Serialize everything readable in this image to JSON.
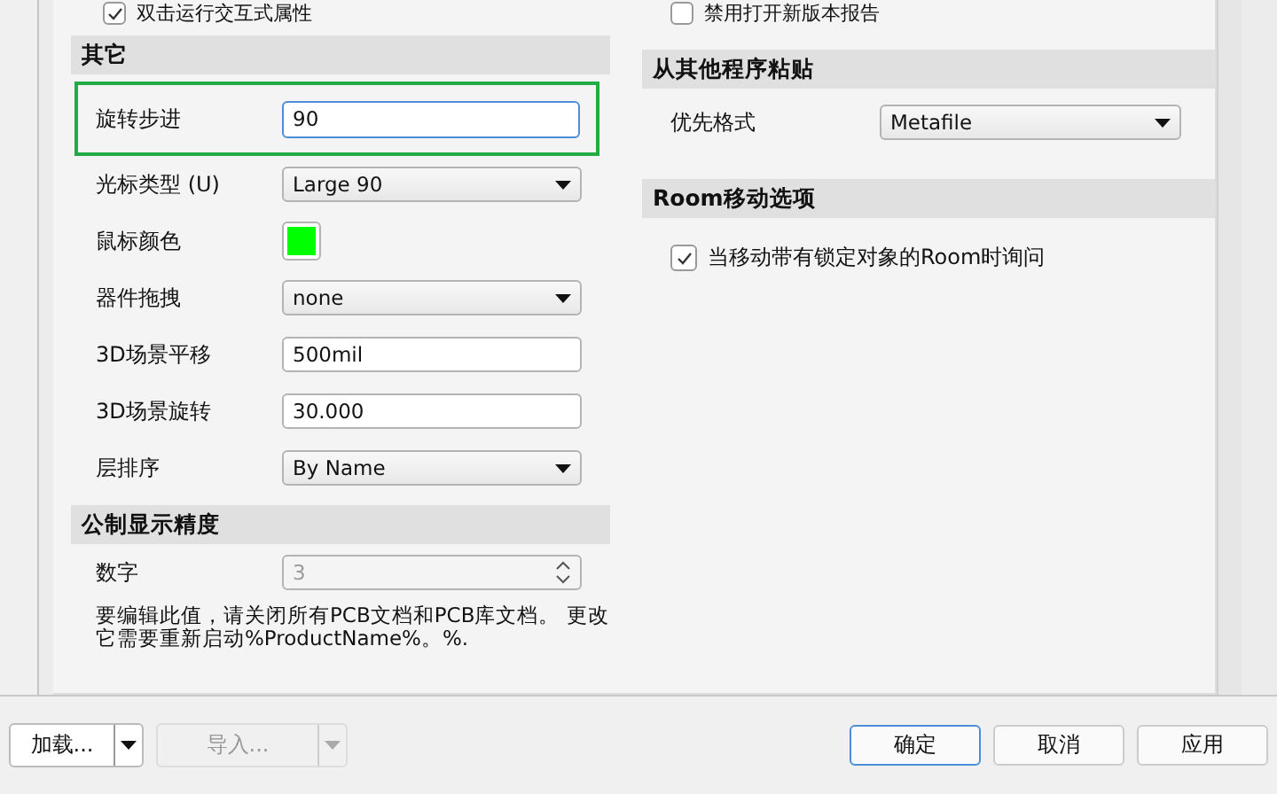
{
  "top_checks": [
    {
      "label": "双击运行交互式属性",
      "checked": true
    },
    {
      "label": "禁用打开新版本报告",
      "checked": false
    }
  ],
  "left_sections": [
    {
      "title": "其它",
      "rows": [
        {
          "kind": "text",
          "label": "旋转步进",
          "value": "90",
          "highlighted": true
        },
        {
          "kind": "select",
          "label": "光标类型 (U)",
          "value": "Large 90",
          "highlighted": false
        },
        {
          "kind": "color",
          "label": "鼠标颜色",
          "color": "#00ff00",
          "highlighted": false
        },
        {
          "kind": "select",
          "label": "器件拖拽",
          "value": "none",
          "highlighted": false
        },
        {
          "kind": "text",
          "label": "3D场景平移",
          "value": "500mil",
          "highlighted": false
        },
        {
          "kind": "text",
          "label": "3D场景旋转",
          "value": "30.000",
          "highlighted": false
        },
        {
          "kind": "select",
          "label": "层排序",
          "value": "By Name",
          "highlighted": false
        }
      ]
    },
    {
      "title": "公制显示精度",
      "rows": [
        {
          "kind": "spin",
          "label": "数字",
          "value": "3",
          "disabled": true,
          "highlighted": false
        }
      ],
      "note": "要编辑此值，请关闭所有PCB文档和PCB库文档。 更改它需要重新启动%ProductName%。%."
    }
  ],
  "right_sections": [
    {
      "title": "从其他程序粘贴",
      "rows": [
        {
          "kind": "select",
          "label": "优先格式",
          "value": "Metafile"
        }
      ]
    },
    {
      "title": "Room移动选项",
      "checks": [
        {
          "label": "当移动带有锁定对象的Room时询问",
          "checked": true
        }
      ]
    }
  ],
  "bottom_left": [
    {
      "label": "加载...",
      "disabled": false
    },
    {
      "label": "导入...",
      "disabled": true
    }
  ],
  "bottom_right": [
    {
      "label": "确定",
      "focused": true
    },
    {
      "label": "取消",
      "focused": false
    },
    {
      "label": "应用",
      "focused": false
    }
  ]
}
